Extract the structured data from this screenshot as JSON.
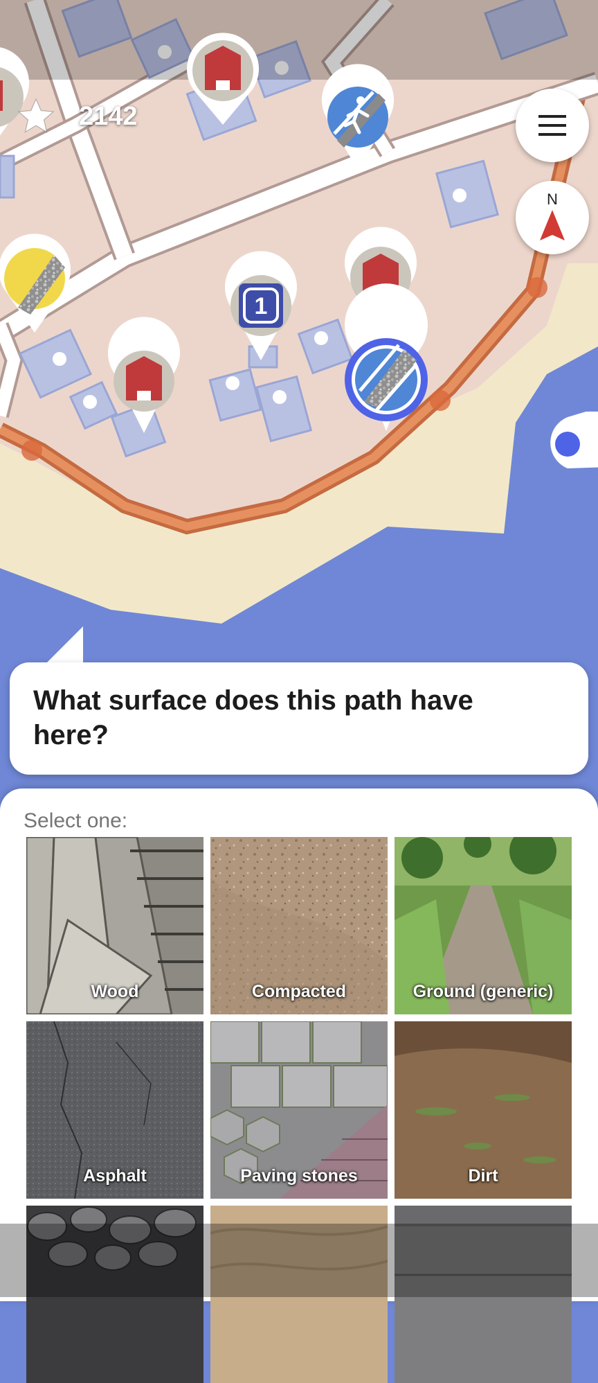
{
  "hud": {
    "star_icon": "star-icon",
    "star_count": "2142"
  },
  "controls": {
    "menu_icon": "hamburger-menu-icon",
    "compass_label": "N",
    "gps_icon": "location-icon"
  },
  "colors": {
    "water": "#6f87d6",
    "land": "#ecd6cc",
    "beach": "#f2e8c9",
    "road": "#ffffff",
    "path": "#e07b4c",
    "selected_ring": "#4f63e6",
    "pin_red": "#c0393b"
  },
  "map_pins": [
    {
      "name": "building-pin",
      "icon": "house-icon"
    },
    {
      "name": "footway-pin",
      "icon": "pedestrian-icon"
    },
    {
      "name": "surface-pin",
      "icon": "surface-icon"
    },
    {
      "name": "building-pin",
      "icon": "house-icon"
    },
    {
      "name": "housenumber-pin",
      "icon": "house-number-icon",
      "label": "1"
    },
    {
      "name": "building-pin",
      "icon": "house-icon"
    },
    {
      "name": "surface-pin-selected",
      "icon": "surface-icon"
    }
  ],
  "quest": {
    "title": "What surface does this path have here?",
    "select_label": "Select one:"
  },
  "options": [
    {
      "label": "Wood",
      "texture": "wood"
    },
    {
      "label": "Compacted",
      "texture": "compacted"
    },
    {
      "label": "Ground (generic)",
      "texture": "ground"
    },
    {
      "label": "Asphalt",
      "texture": "asphalt"
    },
    {
      "label": "Paving stones",
      "texture": "paving"
    },
    {
      "label": "Dirt",
      "texture": "dirt"
    },
    {
      "label": "",
      "texture": "stones"
    },
    {
      "label": "",
      "texture": "sand"
    },
    {
      "label": "",
      "texture": "concrete"
    }
  ]
}
